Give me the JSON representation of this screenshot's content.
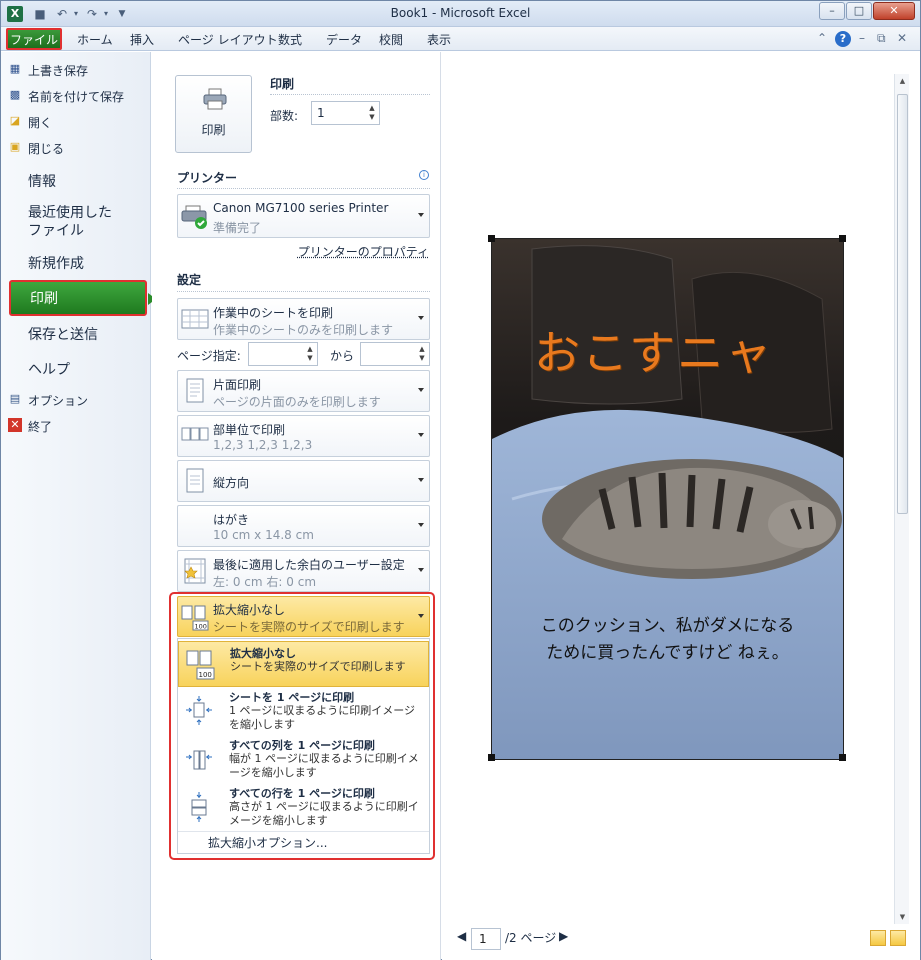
{
  "window": {
    "title": "Book1  -  Microsoft Excel"
  },
  "qat": {
    "excel_icon": "X"
  },
  "ribbon": {
    "file_tab": "ファイル",
    "tabs": [
      "ホーム",
      "挿入",
      "ページ レイアウト",
      "数式",
      "データ",
      "校閲",
      "表示"
    ]
  },
  "backstage": {
    "commands": [
      "上書き保存",
      "名前を付けて保存",
      "開く",
      "閉じる"
    ],
    "nav": {
      "info": "情報",
      "recent_line1": "最近使用した",
      "recent_line2": "ファイル",
      "new": "新規作成",
      "print": "印刷",
      "save_send": "保存と送信",
      "help": "ヘルプ"
    },
    "options": "オプション",
    "exit": "終了"
  },
  "print": {
    "button_label": "印刷",
    "heading": "印刷",
    "copies_label": "部数:",
    "copies_value": "1",
    "printer_heading": "プリンター",
    "printer_name": "Canon MG7100 series Printer",
    "printer_status": "準備完了",
    "printer_properties": "プリンターのプロパティ",
    "settings_heading": "設定",
    "what": {
      "title": "作業中のシートを印刷",
      "sub": "作業中のシートのみを印刷します"
    },
    "pages_label": "ページ指定:",
    "pages_to": "から",
    "sides": {
      "title": "片面印刷",
      "sub": "ページの片面のみを印刷します"
    },
    "collate": {
      "title": "部単位で印刷",
      "sub": "1,2,3    1,2,3    1,2,3"
    },
    "orientation": {
      "title": "縦方向"
    },
    "paper": {
      "title": "はがき",
      "sub": "10 cm x 14.8 cm"
    },
    "margins": {
      "title": "最後に適用した余白のユーザー設定",
      "sub": "左: 0 cm    右: 0 cm"
    },
    "scaling": {
      "title": "拡大縮小なし",
      "sub": "シートを実際のサイズで印刷します"
    }
  },
  "scaling_menu": {
    "items": [
      {
        "title": "拡大縮小なし",
        "desc": "シートを実際のサイズで印刷します"
      },
      {
        "title": "シートを 1 ページに印刷",
        "desc": "1 ページに収まるように印刷イメージを縮小します"
      },
      {
        "title": "すべての列を 1 ページに印刷",
        "desc": "幅が 1 ページに収まるように印刷イメージを縮小します"
      },
      {
        "title": "すべての行を 1 ページに印刷",
        "desc": "高さが 1 ページに収まるように印刷イメージを縮小します"
      }
    ],
    "options": "拡大縮小オプション..."
  },
  "preview": {
    "overlay_text": "おこすニャ",
    "caption_line1": "このクッション、私がダメになる",
    "caption_line2": "ために買ったんですけど ねぇ。",
    "page_current": "1",
    "page_total": "/2 ページ"
  },
  "colors": {
    "file_green": "#1d6e1d",
    "highlight": "#f8d35c",
    "callout_red": "#e03030",
    "overlay_orange": "#e8791e"
  }
}
